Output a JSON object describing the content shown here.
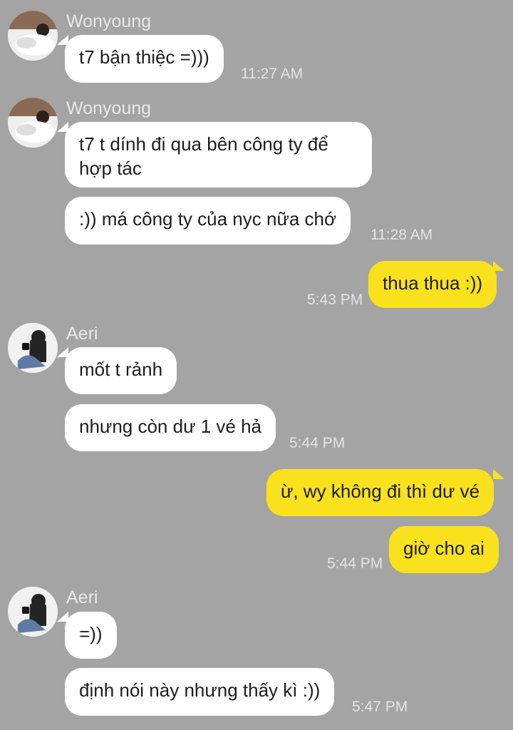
{
  "messages": [
    {
      "sender": "Wonyoung",
      "text": "t7 bận thiệc =)))",
      "time": "11:27 AM"
    },
    {
      "sender": "Wonyoung",
      "text": "t7 t dính đi qua bên công ty để hợp tác"
    },
    {
      "text": ":)) má công ty của nyc nữa chớ",
      "time": "11:28 AM"
    },
    {
      "text": "thua thua :))",
      "time": "5:43 PM"
    },
    {
      "sender": "Aeri",
      "text": "mốt t rảnh"
    },
    {
      "text": "nhưng còn dư 1 vé hả",
      "time": "5:44 PM"
    },
    {
      "text": "ừ, wy không đi thì dư vé"
    },
    {
      "text": "giờ cho ai",
      "time": "5:44 PM"
    },
    {
      "sender": "Aeri",
      "text": "=))"
    },
    {
      "text": "định nói này nhưng thấy kì :))",
      "time": "5:47 PM"
    }
  ],
  "colors": {
    "background": "#a4a4a4",
    "incoming_bubble": "#ffffff",
    "outgoing_bubble": "#f9e11e"
  },
  "icons": {
    "wonyoung_avatar": "avatar-photo",
    "aeri_avatar": "avatar-photo"
  }
}
